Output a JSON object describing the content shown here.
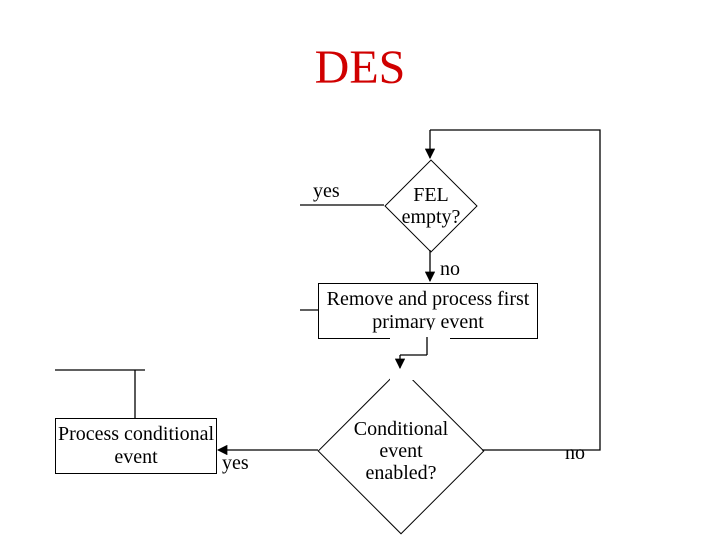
{
  "title": "DES",
  "labels": {
    "yes1": "yes",
    "no1": "no",
    "yes2": "yes",
    "no2": "no"
  },
  "nodes": {
    "fel_decision": "FEL\nempty?",
    "remove_process": "Remove and process first primary event",
    "process_cond": "Process conditional event",
    "cond_decision": "Conditional event enabled?"
  }
}
